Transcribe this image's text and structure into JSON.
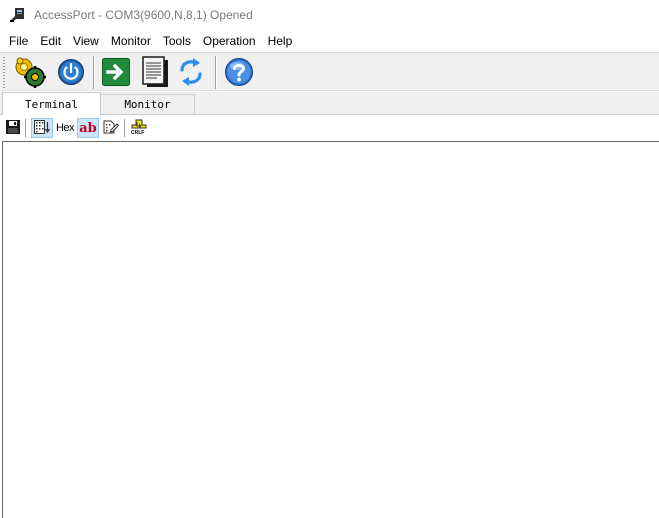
{
  "window": {
    "title": "AccessPort - COM3(9600,N,8,1) Opened",
    "app_icon": "serial-port-icon"
  },
  "menu": [
    "File",
    "Edit",
    "View",
    "Monitor",
    "Tools",
    "Operation",
    "Help"
  ],
  "toolbar": {
    "buttons": [
      {
        "name": "settings-gear-coins-icon"
      },
      {
        "name": "power-icon"
      },
      {
        "name": "send-arrow-icon"
      },
      {
        "name": "document-icon"
      },
      {
        "name": "refresh-icon"
      },
      {
        "name": "help-icon"
      }
    ]
  },
  "tabs": {
    "terminal": "Terminal",
    "monitor": "Monitor",
    "active": "Terminal"
  },
  "subtoolbar": {
    "hex_label": "Hex",
    "ab_label": "ab",
    "crlf_label": "CRLF"
  },
  "colors": {
    "toolbar_bg": "#f0f0f0",
    "pressed_bg": "#cce4f7",
    "title_text": "#7a7a7a",
    "ab_red": "#c0001c"
  }
}
